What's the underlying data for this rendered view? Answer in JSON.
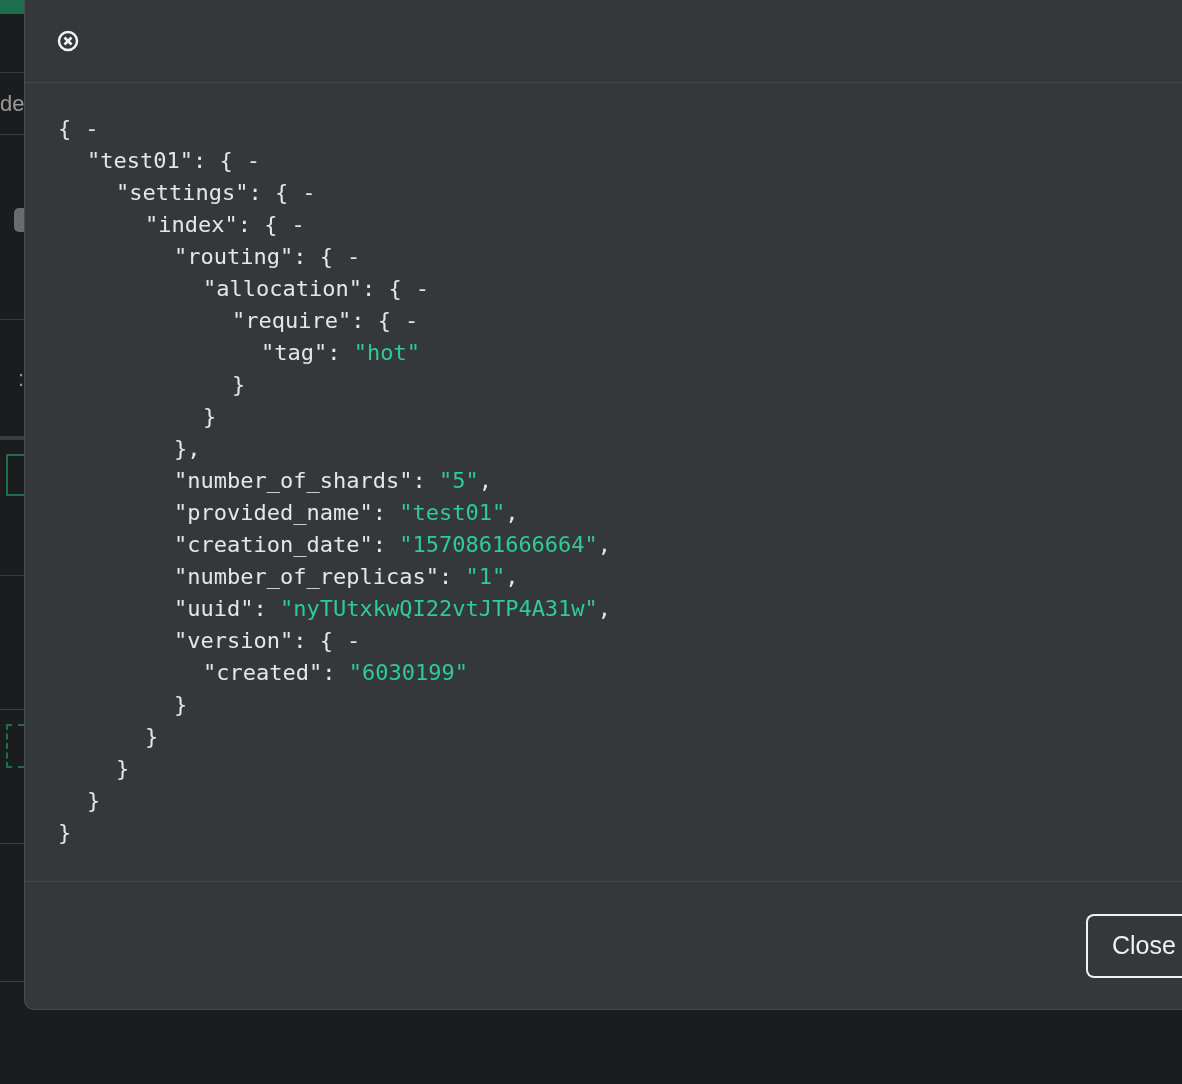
{
  "background": {
    "texts": [
      "de",
      ":"
    ]
  },
  "modal": {
    "json_tree": {
      "open": "{",
      "toggle": "-",
      "close": "}",
      "children": [
        {
          "key": "\"test01\": ",
          "open": "{",
          "toggle": "-",
          "close": "}",
          "children": [
            {
              "key": "\"settings\": ",
              "open": "{",
              "toggle": "-",
              "close": "}",
              "children": [
                {
                  "key": "\"index\": ",
                  "open": "{",
                  "toggle": "-",
                  "close": "}",
                  "children": [
                    {
                      "key": "\"routing\": ",
                      "open": "{",
                      "toggle": "-",
                      "close": "},",
                      "children": [
                        {
                          "key": "\"allocation\": ",
                          "open": "{",
                          "toggle": "-",
                          "close": "}",
                          "children": [
                            {
                              "key": "\"require\": ",
                              "open": "{",
                              "toggle": "-",
                              "close": "}",
                              "children": [
                                {
                                  "key": "\"tag\": ",
                                  "value": "\"hot\""
                                }
                              ]
                            }
                          ]
                        }
                      ]
                    },
                    {
                      "key": "\"number_of_shards\": ",
                      "value": "\"5\"",
                      "tail": ","
                    },
                    {
                      "key": "\"provided_name\": ",
                      "value": "\"test01\"",
                      "tail": ","
                    },
                    {
                      "key": "\"creation_date\": ",
                      "value": "\"1570861666664\"",
                      "tail": ","
                    },
                    {
                      "key": "\"number_of_replicas\": ",
                      "value": "\"1\"",
                      "tail": ","
                    },
                    {
                      "key": "\"uuid\": ",
                      "value": "\"nyTUtxkwQI22vtJTP4A31w\"",
                      "tail": ","
                    },
                    {
                      "key": "\"version\": ",
                      "open": "{",
                      "toggle": "-",
                      "close": "}",
                      "children": [
                        {
                          "key": "\"created\": ",
                          "value": "\"6030199\""
                        }
                      ]
                    }
                  ]
                }
              ]
            }
          ]
        }
      ]
    },
    "button": "Close"
  }
}
